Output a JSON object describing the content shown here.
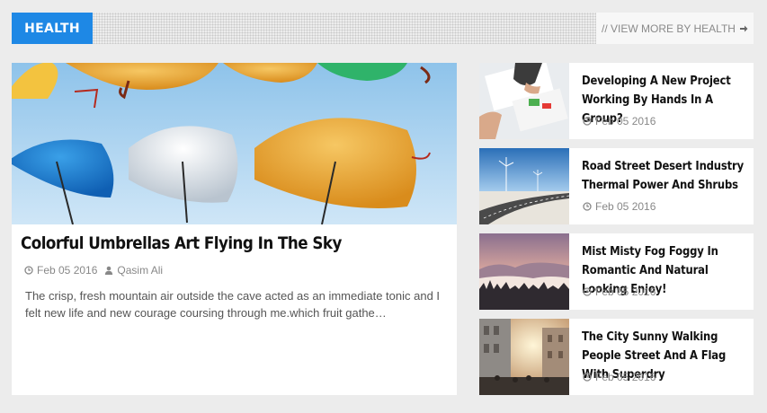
{
  "header": {
    "section_label": "HEALTH",
    "view_more_label": "// VIEW MORE BY HEALTH",
    "view_more_icon": "arrow-right-icon"
  },
  "featured": {
    "title": "Colorful Umbrellas Art Flying In The Sky",
    "date": "Feb 05 2016",
    "author": "Qasim Ali",
    "excerpt": "The crisp, fresh mountain air outside the cave acted as an immediate tonic and I felt new life and new courage coursing through me.which fruit gathe…",
    "image": "umbrellas-sky-image"
  },
  "side_posts": [
    {
      "title": "Developing A New Project Working By Hands In A Group?",
      "date": "Feb 05 2016",
      "image": "hands-working-image"
    },
    {
      "title": "Road Street Desert Industry Thermal Power And Shrubs",
      "date": "Feb 05 2016",
      "image": "desert-road-image"
    },
    {
      "title": "Mist Misty Fog Foggy In Romantic And Natural Looking Enjoy!",
      "date": "Feb 05 2016",
      "image": "misty-forest-image"
    },
    {
      "title": "The City Sunny Walking People Street And A Flag With Superdry",
      "date": "Feb 05 2016",
      "image": "city-street-image"
    }
  ],
  "colors": {
    "accent": "#1e88e5",
    "background": "#ececec",
    "card": "#ffffff",
    "meta_text": "#888888"
  }
}
